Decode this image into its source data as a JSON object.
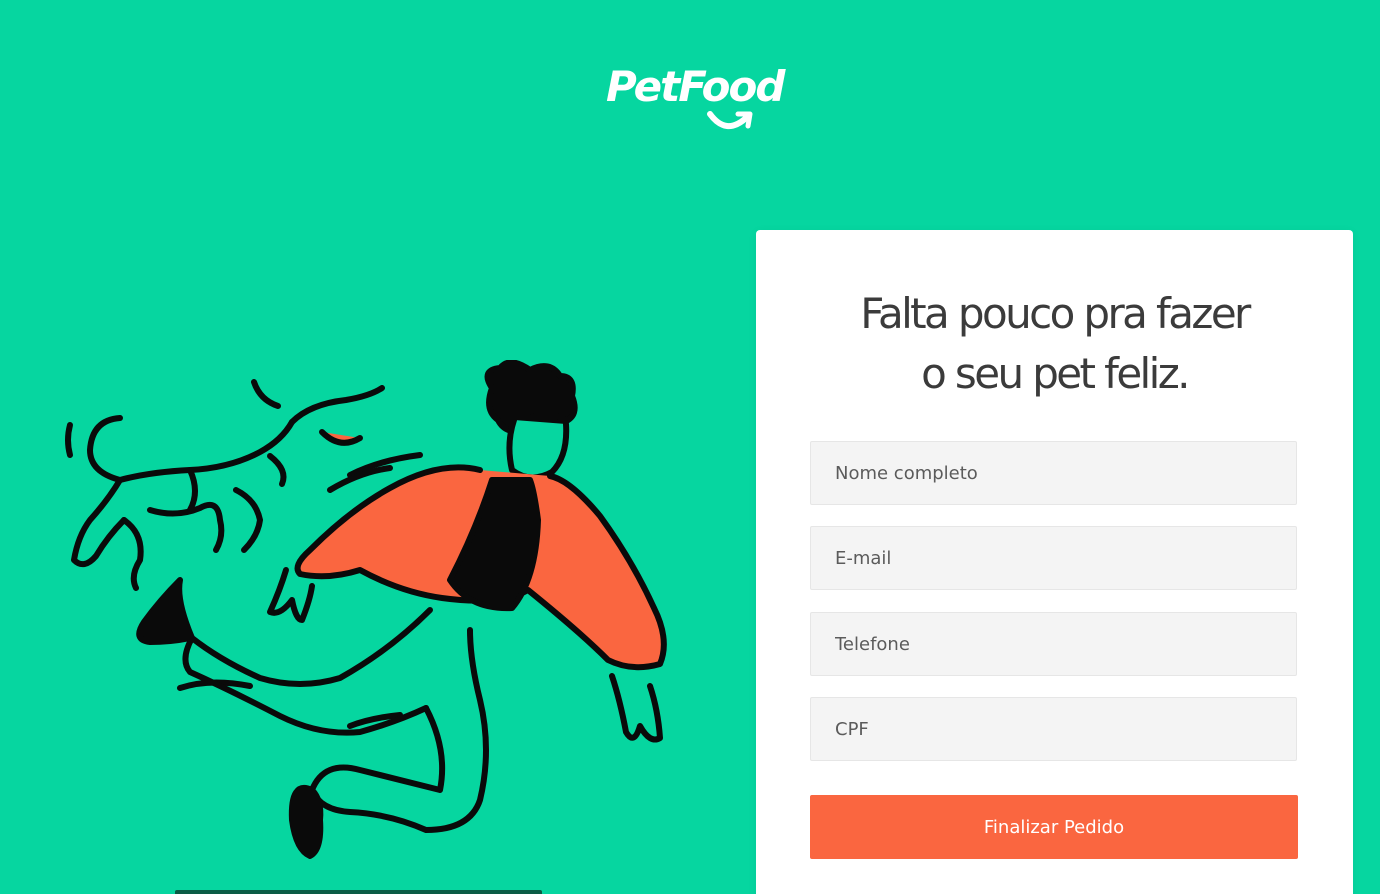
{
  "brand": {
    "logo_text": "PetFood",
    "color_primary": "#06d6a0",
    "color_accent": "#fa6640"
  },
  "form": {
    "headline_line1": "Falta pouco pra fazer",
    "headline_line2": "o seu pet feliz.",
    "fields": [
      {
        "placeholder": "Nome completo",
        "value": ""
      },
      {
        "placeholder": "E-mail",
        "value": ""
      },
      {
        "placeholder": "Telefone",
        "value": ""
      },
      {
        "placeholder": "CPF",
        "value": ""
      }
    ],
    "submit_label": "Finalizar Pedido"
  },
  "illustration": {
    "icon": "person-playing-with-dog-illustration"
  }
}
